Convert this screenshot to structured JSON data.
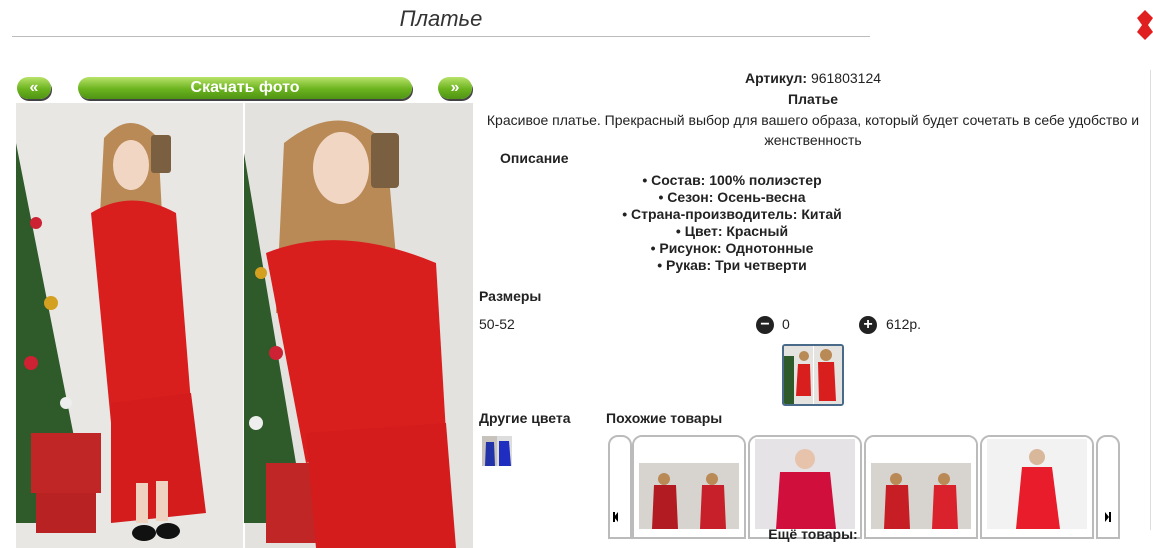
{
  "page_title": "Платье",
  "nav": {
    "prev": "«",
    "next": "»",
    "download": "Скачать фото"
  },
  "product": {
    "article_label": "Артикул:",
    "article_value": "961803124",
    "name": "Платье",
    "description": "Красивое платье. Прекрасный выбор для вашего образа, который будет сочетать в себе удобство и женственность"
  },
  "specs": {
    "heading": "Описание",
    "items": [
      "Состав: 100% полиэстер",
      "Сезон: Осень-весна",
      "Страна-производитель: Китай",
      "Цвет: Красный",
      "Рисунок: Однотонные",
      "Рукав: Три четверти"
    ]
  },
  "sizes": {
    "heading": "Размеры",
    "rows": [
      {
        "size": "50-52",
        "qty": "0",
        "price": "612р."
      }
    ]
  },
  "other_colors": {
    "heading": "Другие цвета"
  },
  "similar": {
    "heading": "Похожие товары",
    "more": "Ещё товары:"
  },
  "colors": {
    "accent_green": "#6bb31e",
    "dress_red": "#d91e1e",
    "close_red": "#e02020"
  }
}
